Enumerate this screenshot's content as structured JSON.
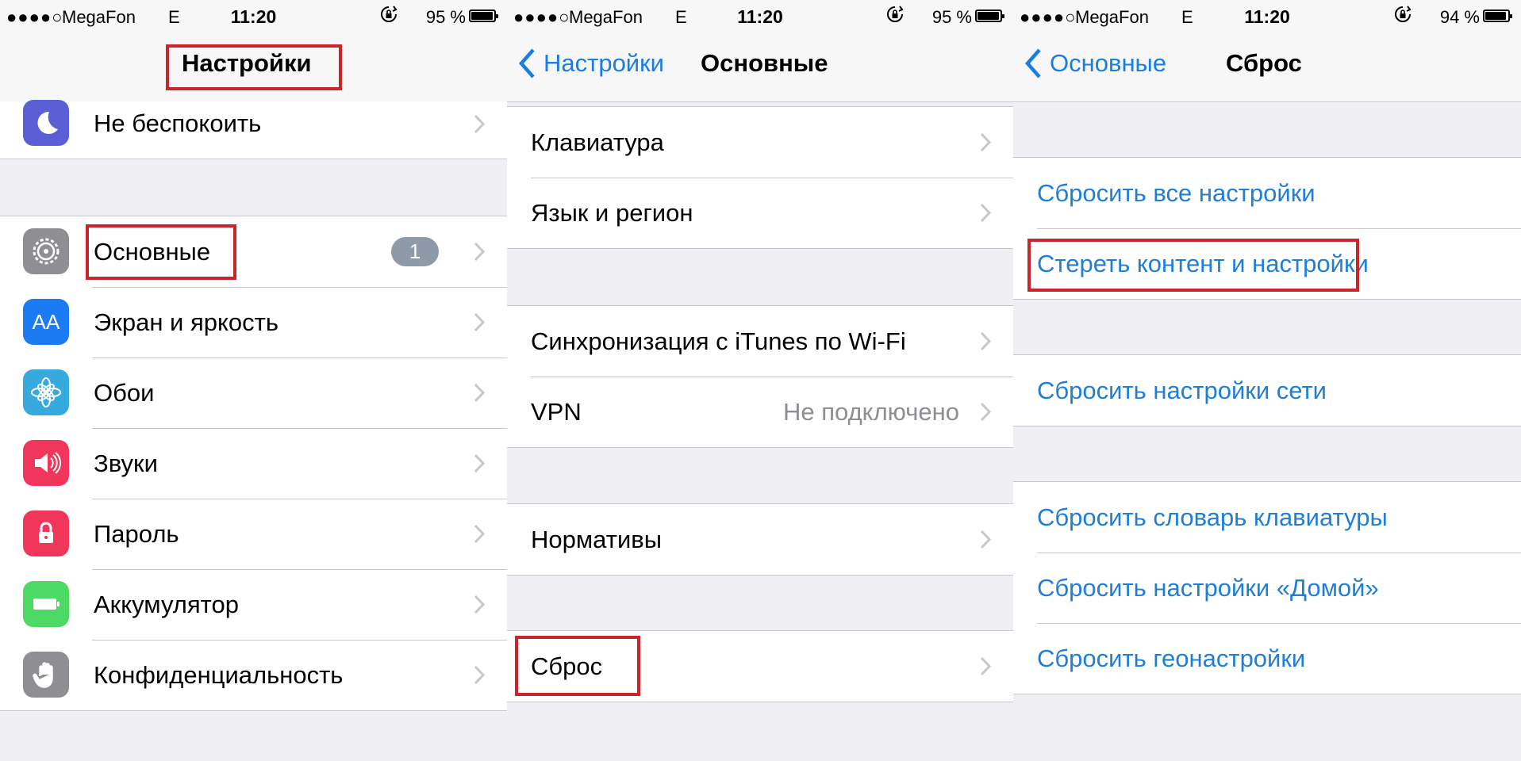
{
  "status_bars": [
    {
      "signal": "●●●●○",
      "carrier": "MegaFon",
      "network": "E",
      "time": "11:20",
      "battery_pct": "95 %",
      "battery_level": 0.95
    },
    {
      "signal": "●●●●○",
      "carrier": "MegaFon",
      "network": "E",
      "time": "11:20",
      "battery_pct": "95 %",
      "battery_level": 0.95
    },
    {
      "signal": "●●●●○",
      "carrier": "MegaFon",
      "network": "E",
      "time": "11:20",
      "battery_pct": "94 %",
      "battery_level": 0.94
    }
  ],
  "panel1": {
    "title": "Настройки",
    "top_item": {
      "label": "Не беспокоить",
      "icon": "moon-icon",
      "color": "#5b5fd6"
    },
    "items": [
      {
        "label": "Основные",
        "icon": "gear-icon",
        "color": "#8e8e93",
        "badge": "1"
      },
      {
        "label": "Экран и яркость",
        "icon": "text-size-icon",
        "icon_text": "AA",
        "color": "#1a7bf2"
      },
      {
        "label": "Обои",
        "icon": "flower-icon",
        "color": "#36aadc"
      },
      {
        "label": "Звуки",
        "icon": "speaker-icon",
        "color": "#f0365a"
      },
      {
        "label": "Пароль",
        "icon": "lock-icon",
        "color": "#f0365a"
      },
      {
        "label": "Аккумулятор",
        "icon": "battery-icon",
        "color": "#4cd964"
      },
      {
        "label": "Конфиденциальность",
        "icon": "hand-icon",
        "color": "#8e8e93"
      }
    ]
  },
  "panel2": {
    "back": "Настройки",
    "title": "Основные",
    "group1": [
      "Клавиатура",
      "Язык и регион"
    ],
    "group2": [
      {
        "label": "Синхронизация с iTunes по Wi-Fi"
      },
      {
        "label": "VPN",
        "value": "Не подключено"
      }
    ],
    "group3": [
      "Нормативы"
    ],
    "group4": [
      "Сброс"
    ]
  },
  "panel3": {
    "back": "Основные",
    "title": "Сброс",
    "group1": [
      "Сбросить все настройки",
      "Стереть контент и настройки"
    ],
    "group2": [
      "Сбросить настройки сети"
    ],
    "group3": [
      "Сбросить словарь клавиатуры",
      "Сбросить настройки «Домой»",
      "Сбросить геонастройки"
    ]
  },
  "colors": {
    "link": "#1f7fd8",
    "highlight": "#c9252b",
    "separator": "#c8c7cc",
    "background": "#efeff4"
  }
}
